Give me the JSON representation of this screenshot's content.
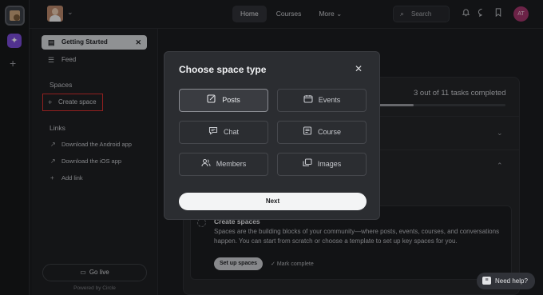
{
  "topbar": {
    "nav": [
      {
        "label": "Home",
        "active": true
      },
      {
        "label": "Courses",
        "active": false
      },
      {
        "label": "More ⌄",
        "active": false
      }
    ],
    "search_label": "Search",
    "user_initials": "AT"
  },
  "sidebar": {
    "items": [
      {
        "label": "Getting Started",
        "icon": "checklist-icon",
        "selected": true
      },
      {
        "label": "Feed",
        "icon": "feed-icon",
        "selected": false
      }
    ],
    "spaces_title": "Spaces",
    "create_space": "Create space",
    "links_title": "Links",
    "links": [
      {
        "label": "Download the Android app",
        "icon": "external-arrow-icon"
      },
      {
        "label": "Download the iOS app",
        "icon": "external-arrow-icon"
      },
      {
        "label": "Add link",
        "icon": "plus-icon"
      }
    ],
    "go_live": "Go live",
    "powered_by": "Powered by Circle"
  },
  "main": {
    "tasks_progress_text": "3 out of 11 tasks completed",
    "tasks_done": 3,
    "tasks_total": 11,
    "create_spaces_title": "Create spaces",
    "create_spaces_desc": "Spaces are the building blocks of your community—where posts, events, courses, and conversations happen. You can start from scratch or choose a template to set up key spaces for you.",
    "setup_button": "Set up spaces",
    "mark_complete": "Mark complete"
  },
  "modal": {
    "title": "Choose space type",
    "options": [
      {
        "label": "Posts",
        "icon": "posts-icon",
        "selected": true
      },
      {
        "label": "Events",
        "icon": "calendar-icon",
        "selected": false
      },
      {
        "label": "Chat",
        "icon": "chat-icon",
        "selected": false
      },
      {
        "label": "Course",
        "icon": "course-icon",
        "selected": false
      },
      {
        "label": "Members",
        "icon": "members-icon",
        "selected": false
      },
      {
        "label": "Images",
        "icon": "images-icon",
        "selected": false
      }
    ],
    "next_label": "Next"
  },
  "help": {
    "label": "Need help?"
  }
}
